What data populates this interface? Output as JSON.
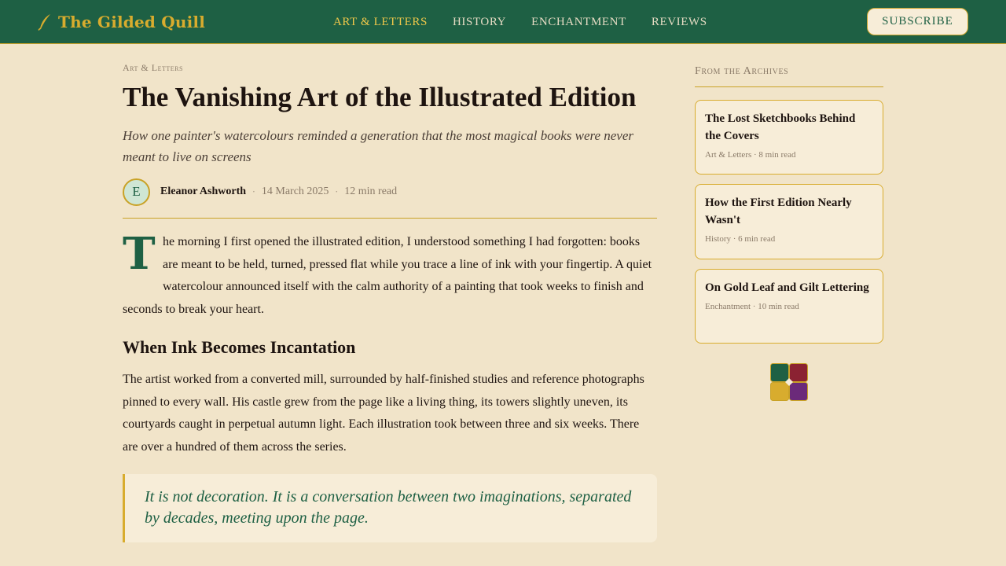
{
  "header": {
    "brand_name": "The Gilded Quill",
    "nav": [
      {
        "label": "ART & LETTERS",
        "active": true
      },
      {
        "label": "HISTORY",
        "active": false
      },
      {
        "label": "ENCHANTMENT",
        "active": false
      },
      {
        "label": "REVIEWS",
        "active": false
      }
    ],
    "subscribe_label": "SUBSCRIBE"
  },
  "article": {
    "kicker": "Art & Letters",
    "title": "The Vanishing Art of the Illustrated Edition",
    "dek": "How one painter's watercolours reminded a generation that the most magical books were never meant to live on screens",
    "author": {
      "initial": "E",
      "name": "Eleanor Ashworth",
      "date": "14 March 2025",
      "read_time": "12 min read"
    },
    "dropcap": "T",
    "lead": "he morning I first opened the illustrated edition, I understood something I had forgotten: books are meant to be held, turned, pressed flat while you trace a line of ink with your fingertip. A quiet watercolour announced itself with the calm authority of a painting that took weeks to finish and seconds to break your heart.",
    "section_heading": "When Ink Becomes Incantation",
    "paragraph2": "The artist worked from a converted mill, surrounded by half-finished studies and reference photographs pinned to every wall. His castle grew from the page like a living thing, its towers slightly uneven, its courtyards caught in perpetual autumn light. Each illustration took between three and six weeks. There are over a hundred of them across the series.",
    "pullquote": "It is not decoration. It is a conversation between two imaginations, separated by decades, meeting upon the page."
  },
  "sidebar": {
    "title": "From the Archives",
    "cards": [
      {
        "title": "The Lost Sketchbooks Behind the Covers",
        "meta": "Art & Letters · 8 min read"
      },
      {
        "title": "How the First Edition Nearly Wasn't",
        "meta": "History · 6 min read"
      },
      {
        "title": "On Gold Leaf and Gilt Lettering",
        "meta": "Enchantment · 10 min read"
      }
    ]
  },
  "colors": {
    "header_green": "#1e6044",
    "gold": "#d8ac2e",
    "parchment": "#f1e4c9",
    "emblem": [
      "#1e6044",
      "#8b2232",
      "#d8ac2e",
      "#6b2a7a"
    ]
  },
  "icons": {
    "brand": "quill-icon",
    "emblem": "four-square-emblem-icon"
  }
}
